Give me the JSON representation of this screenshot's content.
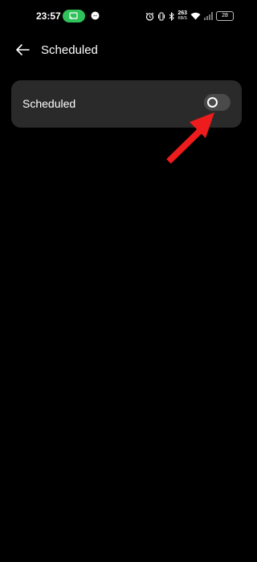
{
  "status_bar": {
    "time": "23:57",
    "net_speed_value": "263",
    "net_speed_unit": "KB/S",
    "battery": "28",
    "icons": [
      "cast-icon",
      "messenger-icon",
      "alarm-icon",
      "vibrate-icon",
      "bluetooth-icon",
      "wifi-icon",
      "signal-icon",
      "battery-icon"
    ]
  },
  "header": {
    "title": "Scheduled",
    "back_icon": "arrow-left-icon"
  },
  "settings": {
    "scheduled_label": "Scheduled",
    "scheduled_enabled": false
  },
  "annotation": {
    "type": "red-arrow",
    "color": "#ee1c1c"
  },
  "colors": {
    "background": "#000000",
    "card": "#2a2a2a",
    "toggle_off": "#4a4a4a",
    "cast_pill": "#2fc25b"
  }
}
